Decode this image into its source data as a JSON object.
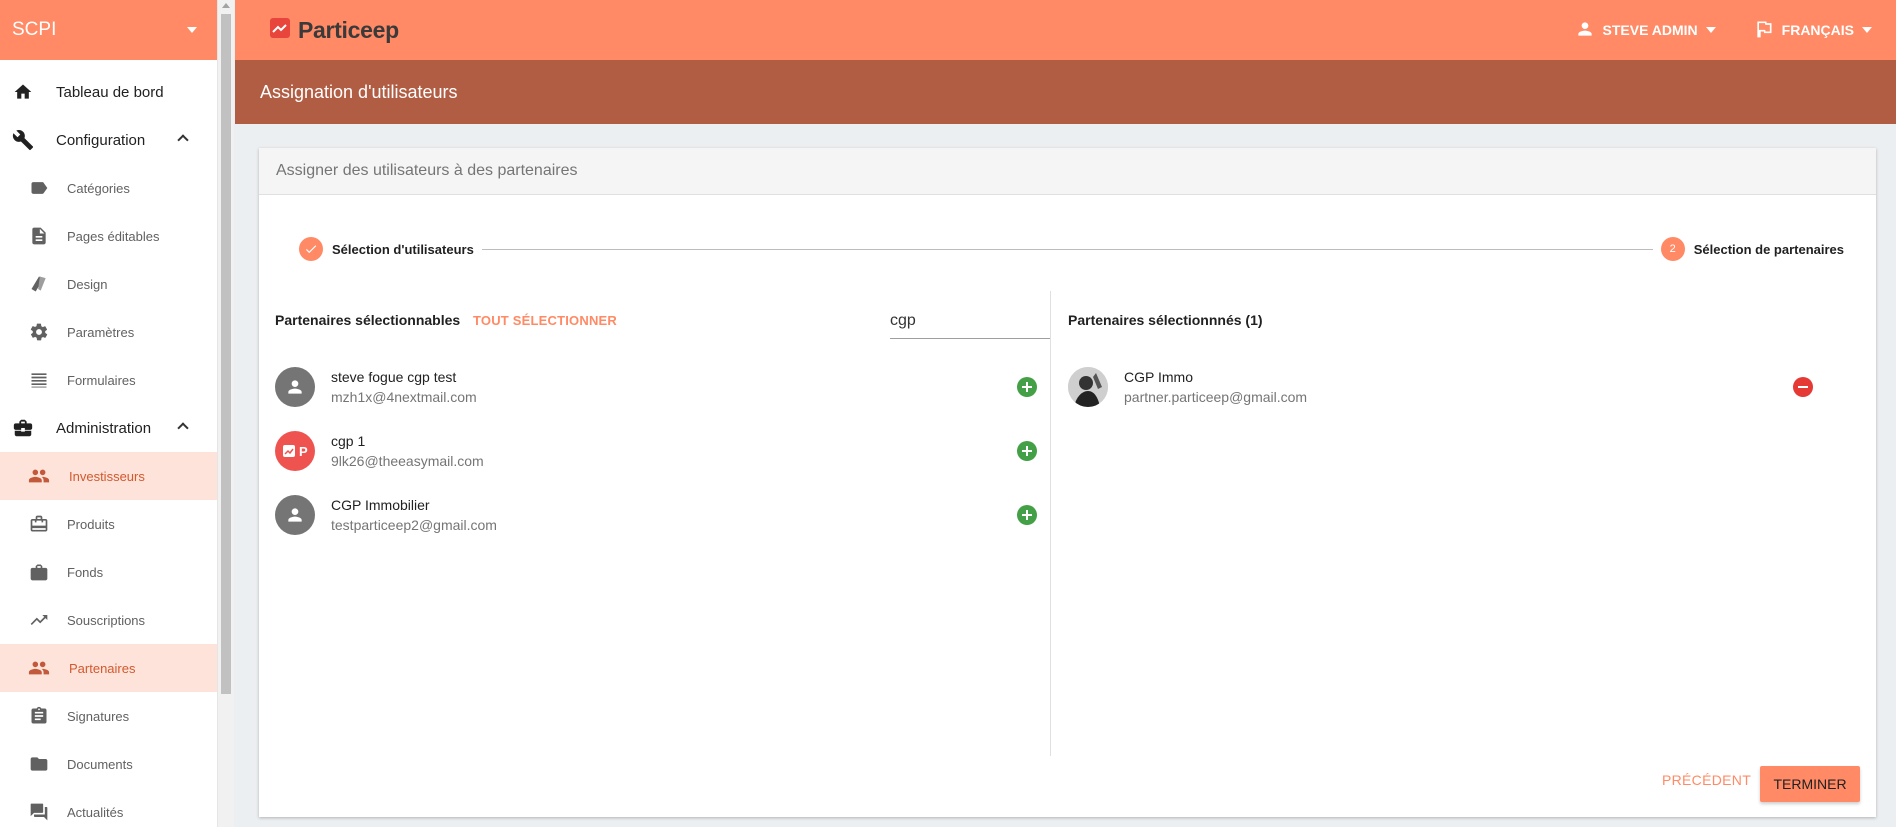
{
  "sidebar": {
    "title": "SCPI",
    "items": [
      {
        "label": "Tableau de bord",
        "icon": "home-icon",
        "level": "top"
      },
      {
        "label": "Configuration",
        "icon": "wrench-icon",
        "level": "top",
        "expanded": true
      },
      {
        "label": "Catégories",
        "icon": "label-icon",
        "level": "sub"
      },
      {
        "label": "Pages éditables",
        "icon": "document-icon",
        "level": "sub"
      },
      {
        "label": "Design",
        "icon": "palette-icon",
        "level": "sub"
      },
      {
        "label": "Paramètres",
        "icon": "gear-icon",
        "level": "sub"
      },
      {
        "label": "Formulaires",
        "icon": "list-icon",
        "level": "sub"
      },
      {
        "label": "Administration",
        "icon": "briefcase-icon",
        "level": "top",
        "expanded": true
      },
      {
        "label": "Investisseurs",
        "icon": "people-icon",
        "level": "sub",
        "active": true
      },
      {
        "label": "Produits",
        "icon": "product-icon",
        "level": "sub"
      },
      {
        "label": "Fonds",
        "icon": "bag-icon",
        "level": "sub"
      },
      {
        "label": "Souscriptions",
        "icon": "trending-icon",
        "level": "sub"
      },
      {
        "label": "Partenaires",
        "icon": "people-icon",
        "level": "sub",
        "active": true
      },
      {
        "label": "Signatures",
        "icon": "clipboard-icon",
        "level": "sub"
      },
      {
        "label": "Documents",
        "icon": "folder-icon",
        "level": "sub"
      },
      {
        "label": "Actualités",
        "icon": "chat-icon",
        "level": "sub"
      }
    ]
  },
  "topbar": {
    "brand": "Particeep",
    "user": "STEVE ADMIN",
    "language": "FRANÇAIS"
  },
  "page": {
    "title": "Assignation d'utilisateurs"
  },
  "card": {
    "title": "Assigner des utilisateurs à des partenaires",
    "steps": [
      {
        "label": "Sélection d'utilisateurs",
        "state": "done"
      },
      {
        "label": "Sélection de partenaires",
        "number": "2",
        "state": "active"
      }
    ],
    "available": {
      "heading": "Partenaires sélectionnables",
      "select_all": "TOUT SÉLECTIONNER",
      "search_value": "cgp",
      "items": [
        {
          "name": "steve fogue cgp test",
          "email": "mzh1x@4nextmail.com",
          "avatar": "person"
        },
        {
          "name": "cgp 1",
          "email": "9lk26@theeasymail.com",
          "avatar": "logo"
        },
        {
          "name": "CGP Immobilier",
          "email": "testparticeep2@gmail.com",
          "avatar": "person"
        }
      ]
    },
    "selected": {
      "heading": "Partenaires sélectionnnés (1)",
      "items": [
        {
          "name": "CGP Immo",
          "email": "partner.particeep@gmail.com",
          "avatar": "photo"
        }
      ]
    },
    "buttons": {
      "previous": "PRÉCÉDENT",
      "finish": "TERMINER"
    }
  },
  "colors": {
    "accent": "#ff8a65",
    "title_bar": "#b05d44",
    "active_bg": "#fde3da",
    "add": "#43a047",
    "remove": "#e53935"
  }
}
